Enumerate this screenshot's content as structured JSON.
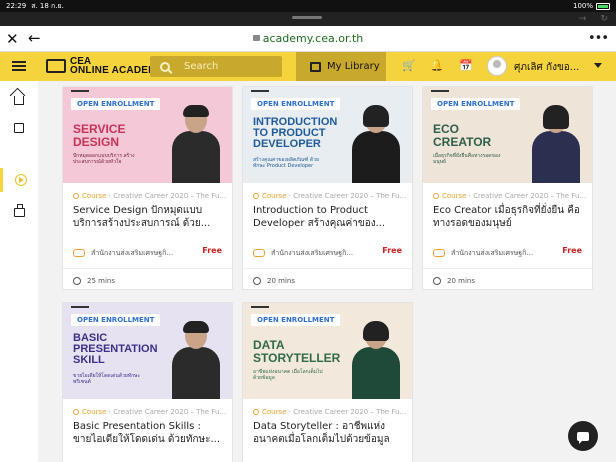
{
  "status": {
    "time": "22:29",
    "date": "ส. 18 ก.ย.",
    "battery": "100%"
  },
  "browser": {
    "url": "academy.cea.or.th"
  },
  "header": {
    "logo_line1": "CEA",
    "logo_line2": "ONLINE ACADEMY",
    "search_placeholder": "Search",
    "my_library": "My Library",
    "username": "ศุภเลิศ กังขอ..."
  },
  "sidebar": {
    "items": [
      "home-icon",
      "calendar-icon",
      "play-icon",
      "briefcase-icon"
    ],
    "active_index": 2
  },
  "colors": {
    "brand": "#f4d33c",
    "brand_dark": "#c9a92c",
    "course": "#f0a030",
    "free": "#d21e1e",
    "badge": "#2e6fd8"
  },
  "cards": [
    {
      "badge": "OPEN ENROLLMENT",
      "thumb_title": "SERVICE DESIGN",
      "thumb_sub": "ปักหมุดออกแบบบริการ สร้างประสบการณ์ด้วยหัวใจ",
      "course_label": "Course",
      "meta": "Creative Career 2020 – The Fu...",
      "title": "Service Design ปักหมุดแบบ บริการสร้างประสบการณ์ ด้วย...",
      "owner": "สำนักงานส่งเสริมเศรษฐกิ...",
      "price": "Free",
      "duration": "25 mins"
    },
    {
      "badge": "OPEN ENROLLMENT",
      "thumb_title": "INTRODUCTION TO PRODUCT DEVELOPER",
      "thumb_sub": "สร้างคุณค่าของผลิตภัณฑ์ ด้วยทักษะ Product Developer",
      "course_label": "Course",
      "meta": "Creative Career 2020 – The Fu...",
      "title": "Introduction to Product Developer สร้างคุณค่าของ...",
      "owner": "สำนักงานส่งเสริมเศรษฐกิ...",
      "price": "Free",
      "duration": "20 mins"
    },
    {
      "badge": "OPEN ENROLLMENT",
      "thumb_title": "ECO CREATOR",
      "thumb_sub": "เมื่อธุรกิจที่ยั่งยืนคือทางรอดของมนุษย์",
      "course_label": "Course",
      "meta": "Creative Career 2020 – The Fu...",
      "title": "Eco Creator เมื่อธุรกิจที่ยั่งยืน คือทางรอดของมนุษย์",
      "owner": "สำนักงานส่งเสริมเศรษฐกิ...",
      "price": "Free",
      "duration": "20 mins"
    },
    {
      "badge": "OPEN ENROLLMENT",
      "thumb_title": "BASIC PRESENTATION SKILL",
      "thumb_sub": "ขายไอเดียให้โดดเด่นด้วยทักษะพรีเซนต์",
      "course_label": "Course",
      "meta": "Creative Career 2020 – The Fu...",
      "title": "Basic Presentation Skills : ขายไอเดียให้โดดเด่น ด้วยทักษะ...",
      "owner": "",
      "price": "",
      "duration": ""
    },
    {
      "badge": "OPEN ENROLLMENT",
      "thumb_title": "DATA STORYTELLER",
      "thumb_sub": "อาชีพแห่งอนาคต เมื่อโลกเต็มไปด้วยข้อมูล",
      "course_label": "Course",
      "meta": "Creative Career 2020 – The Fu...",
      "title": "Data Storyteller : อาชีพแห่ง อนาคตเมื่อโลกเต็มไปด้วยข้อมูล",
      "owner": "",
      "price": "",
      "duration": ""
    }
  ]
}
